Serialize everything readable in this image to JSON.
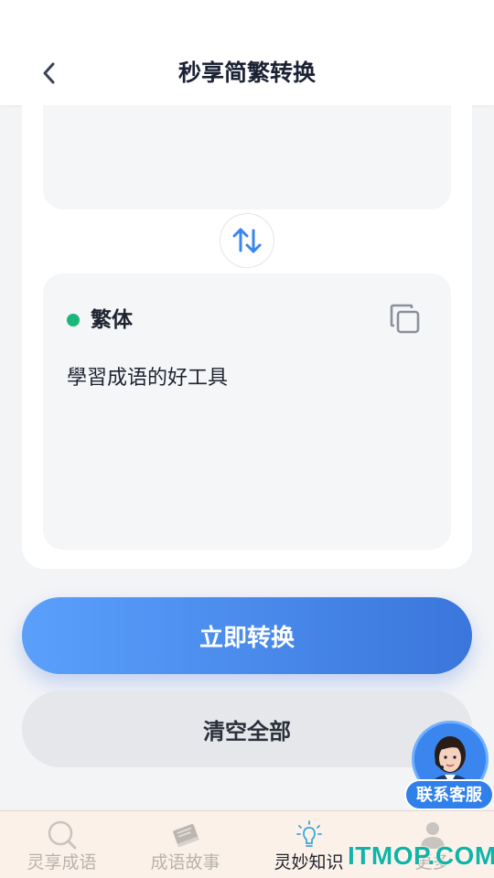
{
  "header": {
    "title": "秒享简繁转换"
  },
  "output": {
    "label": "繁体",
    "text": "學習成语的好工具",
    "dot_color": "#19b77a"
  },
  "actions": {
    "convert_label": "立即转换",
    "clear_label": "清空全部"
  },
  "tabs": [
    {
      "label": "灵享成语",
      "icon": "search-icon",
      "active": false
    },
    {
      "label": "成语故事",
      "icon": "book-icon",
      "active": false
    },
    {
      "label": "灵妙知识",
      "icon": "lightbulb-icon",
      "active": true
    },
    {
      "label": "更多",
      "icon": "user-icon",
      "active": false
    }
  ],
  "support": {
    "label": "联系客服"
  },
  "watermark": "ITMOP.COM",
  "colors": {
    "accent_start": "#5aa0fb",
    "accent_end": "#3a76dc",
    "green_dot": "#19b77a",
    "tabbar_bg": "#fbf1e8"
  }
}
